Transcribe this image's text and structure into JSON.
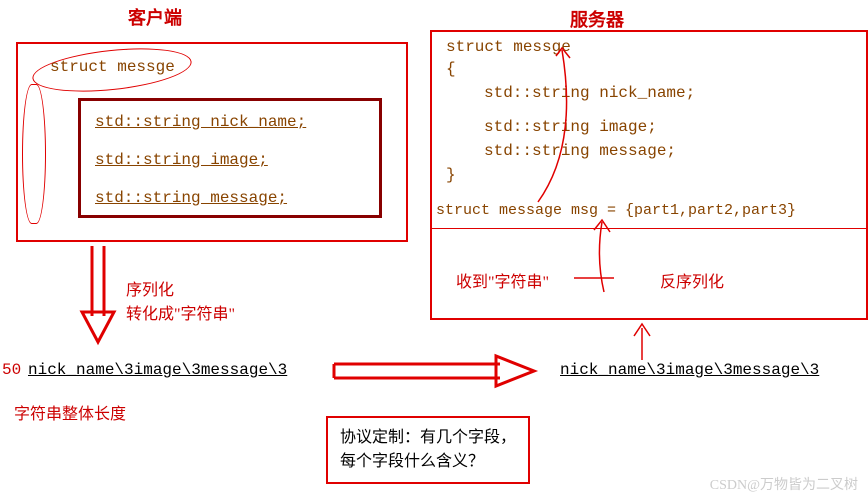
{
  "titles": {
    "client": "客户端",
    "server": "服务器"
  },
  "client": {
    "struct_name": "struct messge",
    "field1": "std::string nick_name;",
    "field2": "std::string image;",
    "field3": "std::string message;",
    "arrow_label1": "序列化",
    "arrow_label2": "转化成\"字符串\"",
    "prefix_num": "50",
    "serialized": "nick_name\\3image\\3message\\3",
    "len_label": "字符串整体长度"
  },
  "server": {
    "struct_open": "struct messge",
    "brace_open": "{",
    "field1": "std::string nick_name;",
    "field2": "std::string image;",
    "field3": "std::string message;",
    "brace_close": "}",
    "instantiate": "struct message msg = {part1,part2,part3}",
    "recv_label": "收到\"字符串\"",
    "deser_label": "反序列化",
    "serialized": "nick_name\\3image\\3message\\3"
  },
  "note": {
    "line1": "协议定制：有几个字段，",
    "line2": "每个字段什么含义？"
  },
  "watermark": "CSDN@万物皆为二叉树"
}
